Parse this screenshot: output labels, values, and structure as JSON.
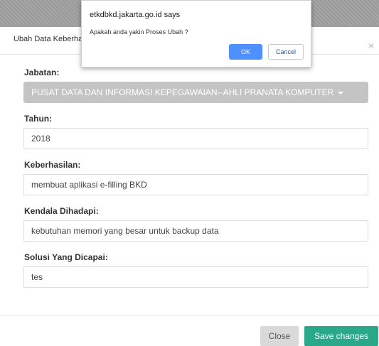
{
  "modal": {
    "title": "Ubah Data Keberha",
    "close_symbol": "×"
  },
  "form": {
    "jabatan": {
      "label": "Jabatan:",
      "value": "PUSAT DATA DAN INFORMASI KEPEGAWAIAN--AHLI PRANATA KOMPUTER"
    },
    "tahun": {
      "label": "Tahun:",
      "value": "2018"
    },
    "keberhasilan": {
      "label": "Keberhasilan:",
      "value": "membuat aplikasi e-filling BKD"
    },
    "kendala": {
      "label": "Kendala Dihadapi:",
      "value": "kebutuhan memori yang besar untuk backup data"
    },
    "solusi": {
      "label": "Solusi Yang Dicapai:",
      "value": "tes"
    }
  },
  "footer": {
    "close_label": "Close",
    "save_label": "Save changes"
  },
  "dialog": {
    "title": "etkdbkd.jakarta.go.id says",
    "message": "Apakah anda yakin Proses Ubah ?",
    "ok_label": "OK",
    "cancel_label": "Cancel"
  },
  "colors": {
    "save_button": "#2aa889",
    "ok_button": "#4d90fe",
    "select_disabled": "#c4c4c4"
  }
}
